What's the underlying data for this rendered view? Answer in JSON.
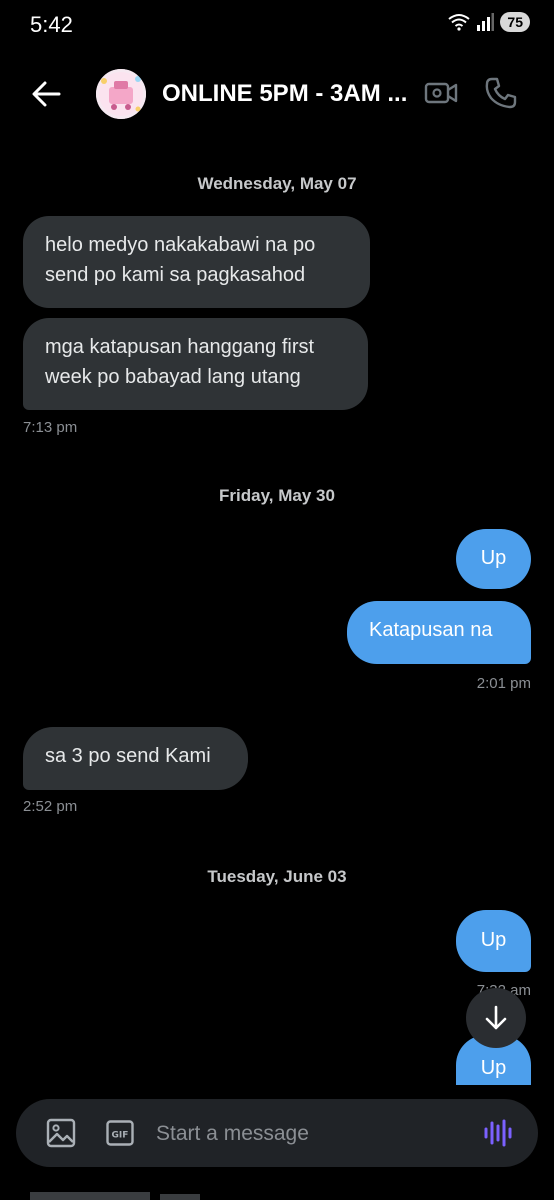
{
  "status_bar": {
    "time": "5:42",
    "battery": "75",
    "icons": [
      "wifi-icon",
      "signal-icon",
      "battery-icon"
    ]
  },
  "header": {
    "title": "ONLINE 5PM - 3AM ...",
    "icons": [
      "back-arrow-icon",
      "video-call-icon",
      "phone-call-icon"
    ]
  },
  "conversation": {
    "day1": {
      "date": "Wednesday, May 07",
      "msg1_line1": "helo medyo nakakabawi na po",
      "msg1_line2": "send po kami sa pagkasahod",
      "msg2_line1": "mga katapusan hanggang first",
      "msg2_line2": "week po babayad lang utang",
      "time": "7:13 pm"
    },
    "day2": {
      "date": "Friday, May 30",
      "out1": "Up",
      "out2": "Katapusan na",
      "out_time": "2:01 pm",
      "in1": "sa 3 po send Kami",
      "in_time": "2:52 pm"
    },
    "day3": {
      "date": "Tuesday, June 03",
      "out1": "Up",
      "out1_time": "7:32 am",
      "out2": "Up"
    }
  },
  "composer": {
    "placeholder": "Start a message",
    "gif_label": "GIF",
    "icons": [
      "image-icon",
      "gif-icon",
      "voice-icon"
    ]
  },
  "colors": {
    "background": "#000000",
    "incoming_bubble": "#2f3336",
    "outgoing_bubble": "#4d9fec",
    "voice_accent": "#7b61ff",
    "timestamp": "#8b8f94"
  }
}
